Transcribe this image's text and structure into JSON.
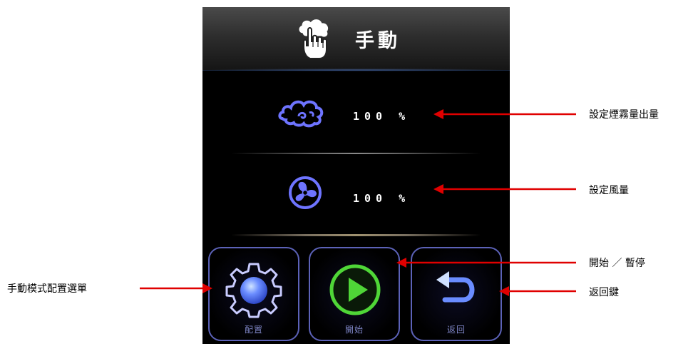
{
  "header": {
    "title": "手動",
    "icon": "hand-pointer-cloud-icon"
  },
  "rows": [
    {
      "icon": "cloud-icon",
      "value": "100 %"
    },
    {
      "icon": "fan-icon",
      "value": "100 %"
    }
  ],
  "buttons": [
    {
      "label": "配置",
      "icon": "gear-icon"
    },
    {
      "label": "開始",
      "icon": "play-icon"
    },
    {
      "label": "返回",
      "icon": "back-arrow-icon"
    }
  ],
  "annotations": {
    "smoke_output": "設定煙霧量出量",
    "air_volume": "設定風量",
    "start_pause": "開始 ／ 暫停",
    "back_key": "返回鍵",
    "config_menu": "手動模式配置選單"
  },
  "colors": {
    "accent_blue": "#5c62b8",
    "icon_blue": "#6e74ff",
    "play_green": "#4fd637",
    "arrow_red": "#e00000"
  }
}
